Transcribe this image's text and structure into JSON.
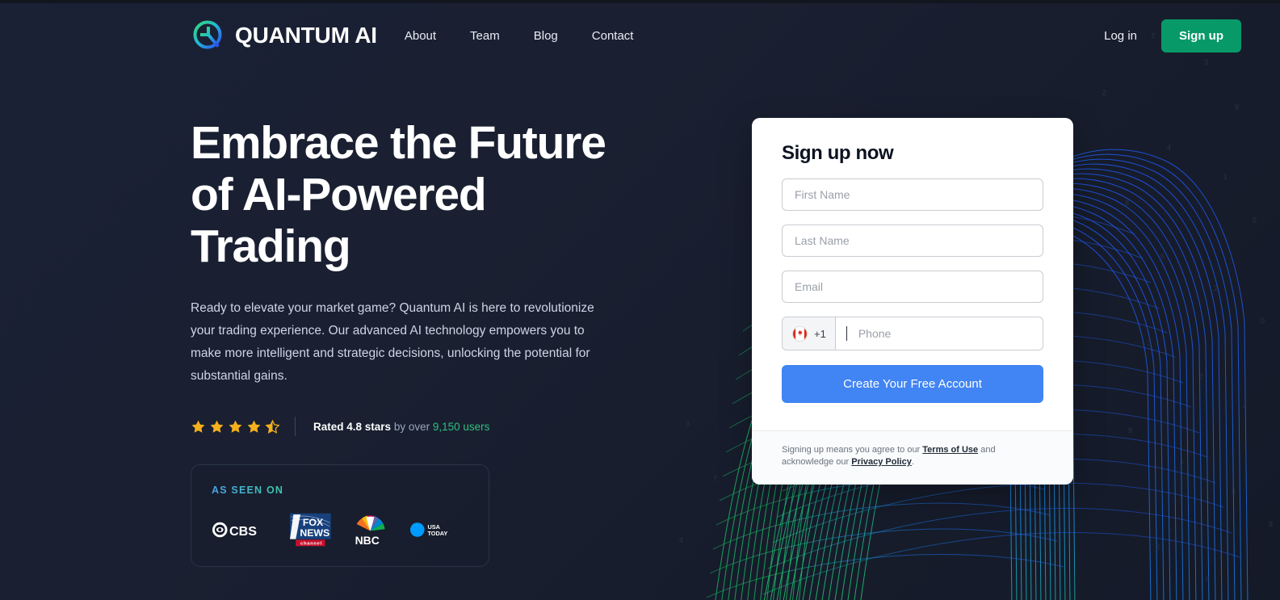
{
  "header": {
    "brand_name": "QUANTUM AI",
    "logo_icon": "quantum-q-logo-icon",
    "nav": [
      {
        "label": "About"
      },
      {
        "label": "Team"
      },
      {
        "label": "Blog"
      },
      {
        "label": "Contact"
      }
    ],
    "login_label": "Log in",
    "signup_label": "Sign up"
  },
  "hero": {
    "title": "Embrace the Future\nof AI-Powered\nTrading",
    "subtitle": "Ready to elevate your market game? Quantum AI is here to revolutionize your trading experience. Our advanced AI technology empowers you to make more intelligent and strategic decisions, unlocking the potential for substantial gains.",
    "rating": {
      "stars_filled": 4,
      "stars_half": 1,
      "stars_total": 5,
      "score_text": "Rated 4.8 stars",
      "middle_text": " by over ",
      "users_text": "9,150 users"
    },
    "as_seen_on": {
      "label": "AS SEEN ON",
      "logos": [
        {
          "name": "cbs-logo",
          "text": "CBS"
        },
        {
          "name": "fox-news-logo",
          "text": "FOX NEWS channel"
        },
        {
          "name": "nbc-logo",
          "text": "NBC"
        },
        {
          "name": "usa-today-logo",
          "text": "USA TODAY"
        }
      ]
    }
  },
  "signup_form": {
    "title": "Sign up now",
    "first_name": {
      "value": "",
      "placeholder": "First Name"
    },
    "last_name": {
      "value": "",
      "placeholder": "Last Name"
    },
    "email": {
      "value": "",
      "placeholder": "Email"
    },
    "phone": {
      "value": "",
      "placeholder": "Phone",
      "country_flag": "canada-flag-icon",
      "dial_code": "+1"
    },
    "submit_label": "Create Your Free Account",
    "footer": {
      "text_before": "Signing up means you agree to our ",
      "terms_label": "Terms of Use",
      "text_middle": " and acknowledge our ",
      "privacy_label": "Privacy Policy",
      "text_after": "."
    }
  },
  "colors": {
    "page_background": "#161b2b",
    "brand_green": "#079a68",
    "cta_blue": "#4184f3",
    "users_green": "#2fbf7e",
    "star_gold": "#f5b01e",
    "card_white": "#ffffff",
    "mesh_green": "#22c06a",
    "mesh_blue": "#1f6ef0"
  }
}
